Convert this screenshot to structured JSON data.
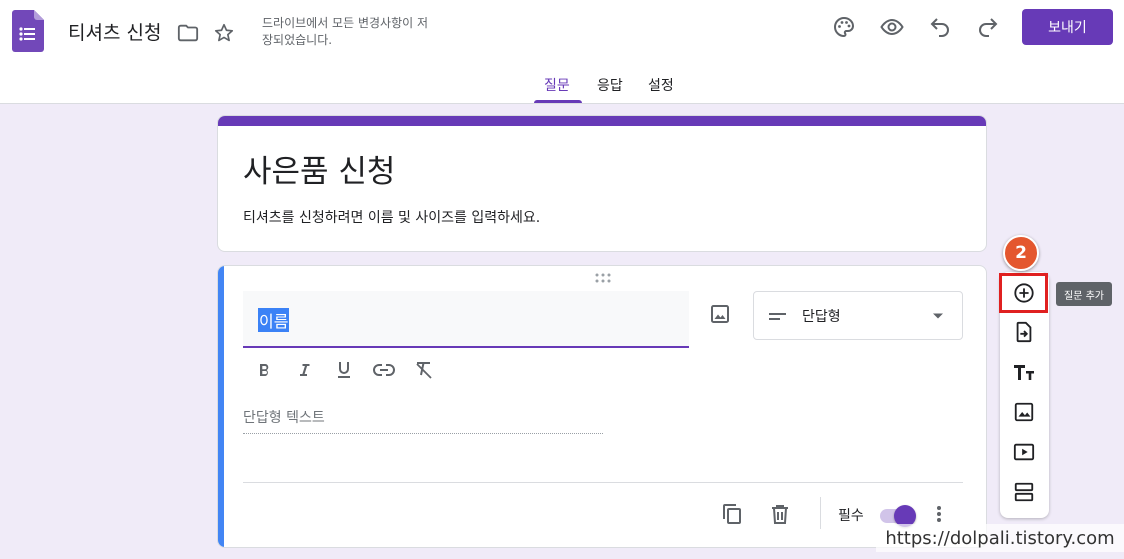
{
  "header": {
    "doc_title": "티셔츠 신청",
    "save_status": "드라이브에서 모든 변경사항이 저장되었습니다.",
    "send_label": "보내기",
    "icons": [
      "forms-logo-icon",
      "folder-icon",
      "star-icon",
      "palette-icon",
      "preview-eye-icon",
      "undo-icon",
      "redo-icon"
    ]
  },
  "tabs": [
    {
      "label": "질문",
      "active": true
    },
    {
      "label": "응답",
      "active": false
    },
    {
      "label": "설정",
      "active": false
    }
  ],
  "form": {
    "title": "사은품 신청",
    "description": "티셔츠를 신청하려면 이름 및 사이즈를 입력하세요."
  },
  "question": {
    "title": "이름",
    "type_label": "단답형",
    "answer_placeholder": "단답형 텍스트",
    "required_label": "필수",
    "required": true
  },
  "side_toolbar": {
    "step_number": "2",
    "tooltip": "질문 추가",
    "items": [
      "add-question-icon",
      "import-questions-icon",
      "add-title-icon",
      "add-image-icon",
      "add-video-icon",
      "add-section-icon"
    ]
  },
  "watermark": "https://dolpali.tistory.com",
  "colors": {
    "accent": "#673ab7",
    "background": "#f0ebf8",
    "focus_bar": "#4285f4",
    "highlight": "#e02020",
    "badge": "#e4572e"
  }
}
